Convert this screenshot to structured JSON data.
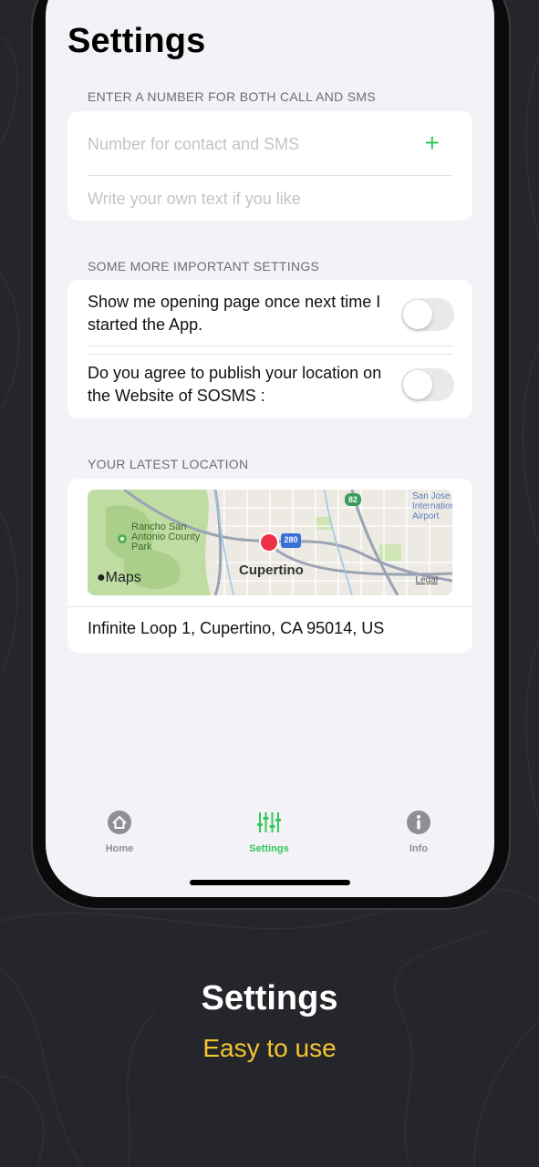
{
  "page": {
    "title": "Settings"
  },
  "contact_section": {
    "header": "ENTER A NUMBER FOR BOTH  CALL AND SMS",
    "number_placeholder": "Number for contact and SMS",
    "text_placeholder": "Write your own text if you like",
    "add_icon": "plus-icon"
  },
  "more_settings": {
    "header": "SOME MORE IMPORTANT SETTINGS",
    "toggles": [
      {
        "label": "Show me opening page once next time I started the App.",
        "on": false
      },
      {
        "label": "Do you agree to publish your location on the Website of SOSMS :",
        "on": false
      }
    ]
  },
  "location": {
    "header": "YOUR LATEST LOCATION",
    "map": {
      "brand": "Maps",
      "legal": "Legal",
      "labels": [
        "Rancho San Antonio County Park",
        "Cupertino",
        "San Jose International Airport"
      ],
      "shields": [
        "280",
        "82"
      ]
    },
    "address": "Infinite Loop 1, Cupertino, CA 95014, US"
  },
  "tabbar": {
    "tabs": [
      {
        "label": "Home",
        "icon": "house-icon",
        "active": false
      },
      {
        "label": "Settings",
        "icon": "sliders-icon",
        "active": true
      },
      {
        "label": "Info",
        "icon": "info-icon",
        "active": false
      }
    ]
  },
  "caption": {
    "title": "Settings",
    "subtitle": "Easy to use"
  },
  "colors": {
    "accent": "#34c759",
    "caption_sub": "#f4c430",
    "background": "#25262b"
  }
}
